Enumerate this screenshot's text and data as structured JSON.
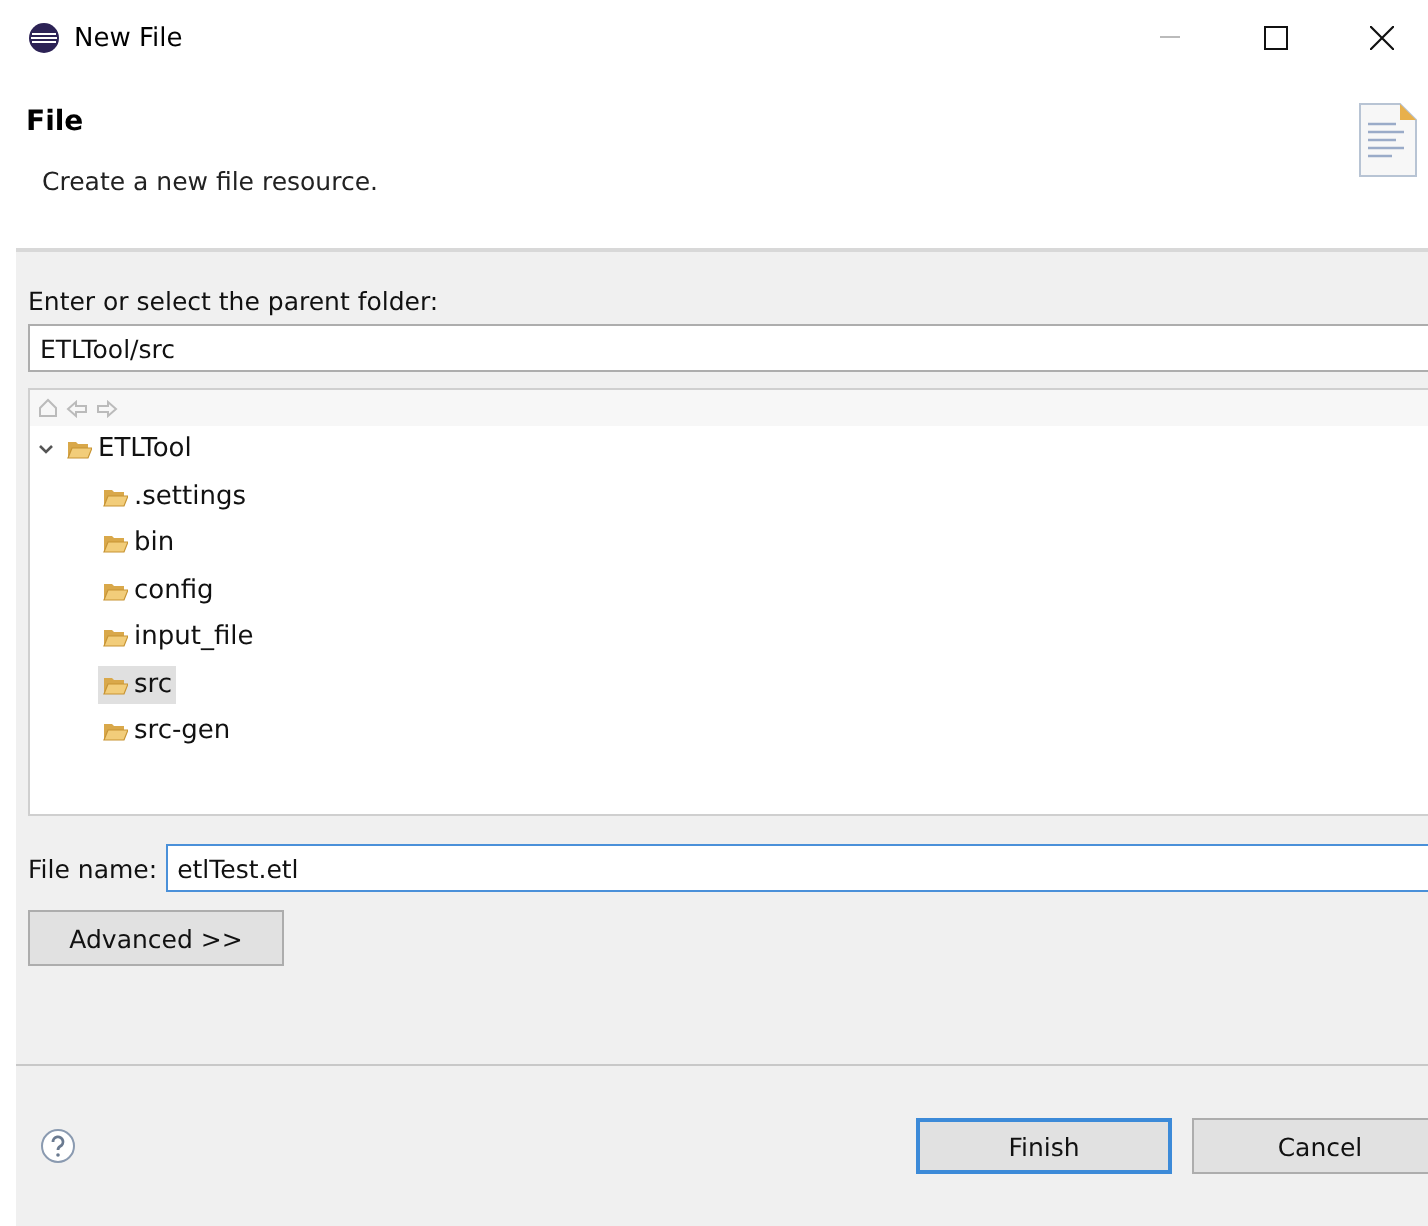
{
  "window": {
    "title": "New File"
  },
  "header": {
    "title": "File",
    "description": "Create a new file resource."
  },
  "parent_folder": {
    "label": "Enter or select the parent folder:",
    "value": "ETLTool/src"
  },
  "tree": [
    {
      "label": "ETLTool",
      "expanded": true,
      "selected": false,
      "children": [
        {
          "label": ".settings",
          "selected": false
        },
        {
          "label": "bin",
          "selected": false
        },
        {
          "label": "config",
          "selected": false
        },
        {
          "label": "input_file",
          "selected": false
        },
        {
          "label": "src",
          "selected": true
        },
        {
          "label": "src-gen",
          "selected": false
        }
      ]
    }
  ],
  "file_name": {
    "label": "File name:",
    "value": "etlTest.etl"
  },
  "advanced_button": "Advanced >>",
  "buttons": [
    {
      "label": "Finish",
      "default": true
    },
    {
      "label": "Cancel",
      "default": false
    }
  ]
}
